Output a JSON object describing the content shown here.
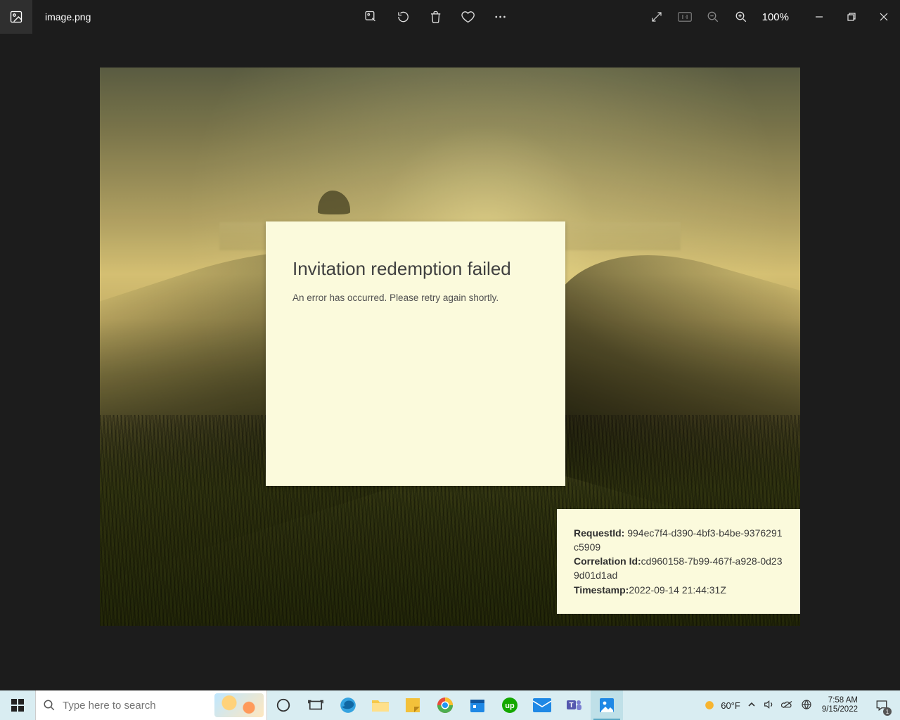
{
  "window": {
    "filename": "image.png",
    "zoom_label": "100%"
  },
  "error_card": {
    "title": "Invitation redemption failed",
    "message": "An error has occurred. Please retry again shortly."
  },
  "details": {
    "request_label": "RequestId:",
    "request_value": " 994ec7f4-d390-4bf3-b4be-9376291c5909",
    "correlation_label": "Correlation Id:",
    "correlation_value": "cd960158-7b99-467f-a928-0d239d01d1ad",
    "timestamp_label": "Timestamp:",
    "timestamp_value": "2022-09-14 21:44:31Z"
  },
  "taskbar": {
    "search_placeholder": "Type here to search",
    "weather_temp": "60°F",
    "clock_time": "7:58 AM",
    "clock_date": "9/15/2022",
    "notification_count": "1"
  }
}
